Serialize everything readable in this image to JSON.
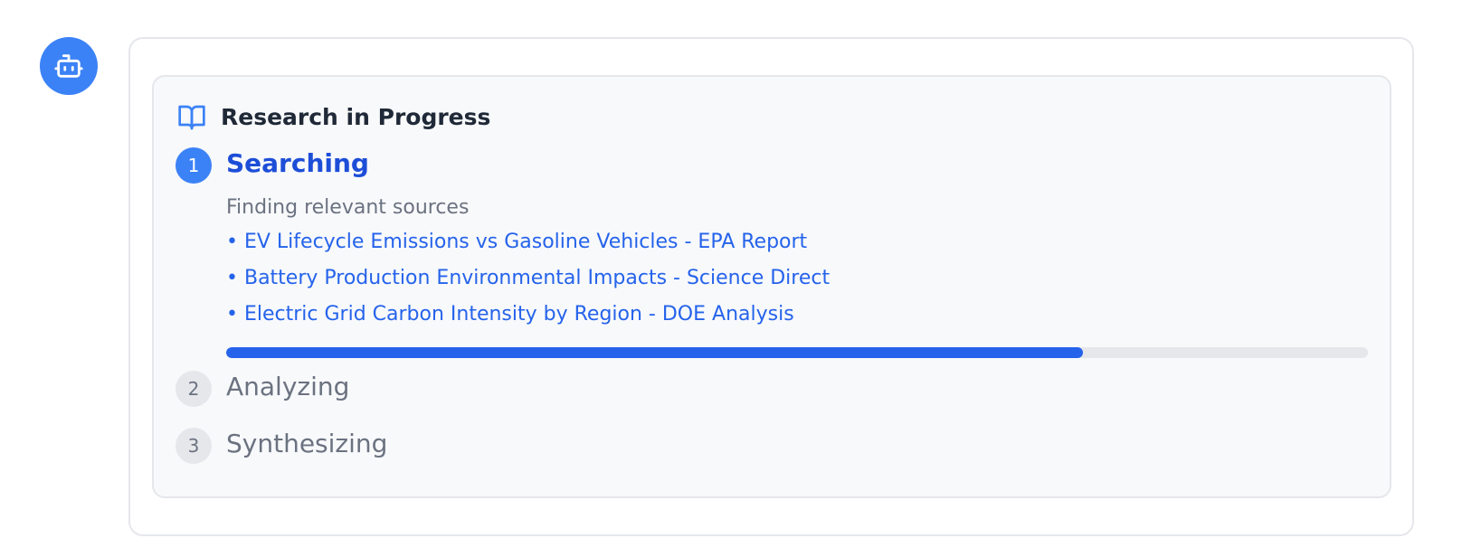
{
  "colors": {
    "accent": "#3b82f6",
    "link": "#2563eb",
    "active_title": "#1d4ed8",
    "muted": "#6b7280",
    "pending_badge_bg": "#e5e7eb"
  },
  "assistant": {
    "avatar_icon": "robot-icon"
  },
  "research": {
    "header_icon": "book-open-icon",
    "title": "Research in Progress",
    "steps": [
      {
        "number": "1",
        "label": "Searching",
        "status": "active",
        "description": "Finding relevant sources",
        "sources": [
          "• EV Lifecycle Emissions vs Gasoline Vehicles - EPA Report",
          "• Battery Production Environmental Impacts - Science Direct",
          "• Electric Grid Carbon Intensity by Region - DOE Analysis"
        ],
        "progress_percent": 75
      },
      {
        "number": "2",
        "label": "Analyzing",
        "status": "pending"
      },
      {
        "number": "3",
        "label": "Synthesizing",
        "status": "pending"
      }
    ]
  }
}
